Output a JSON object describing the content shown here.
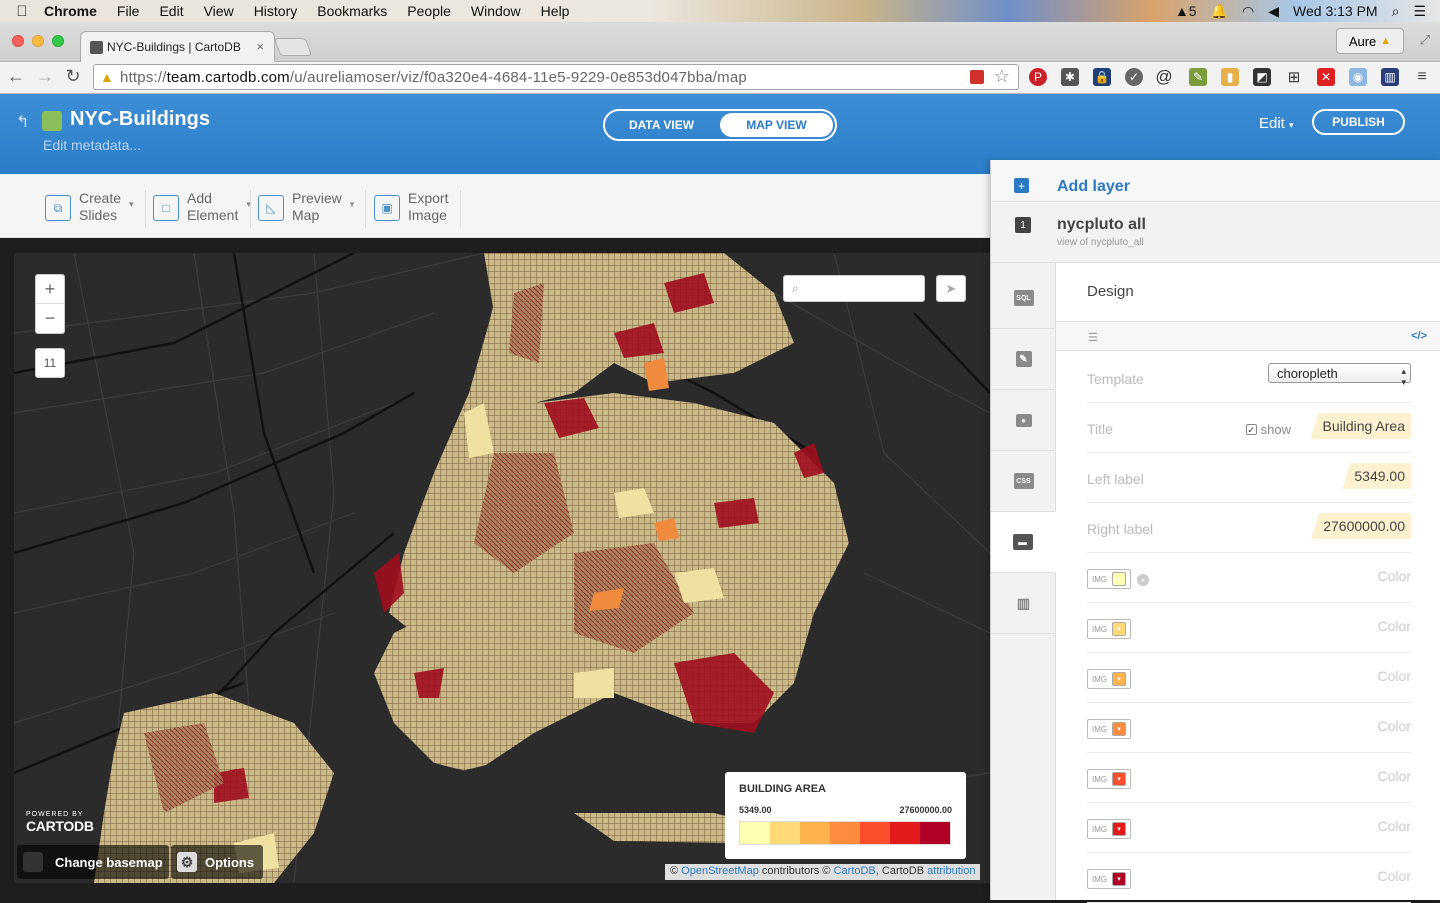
{
  "menubar": {
    "app": "Chrome",
    "items": [
      "File",
      "Edit",
      "View",
      "History",
      "Bookmarks",
      "People",
      "Window",
      "Help"
    ],
    "status_count": "5",
    "clock": "Wed 3:13 PM"
  },
  "browser": {
    "tab_title": "NYC-Buildings | CartoDB",
    "profile": "Aure",
    "url_scheme": "https://",
    "url_host": "team.cartodb.com",
    "url_path": "/u/aureliamoser/viz/f0a320e4-4684-11e5-9229-0e853d047bba/map"
  },
  "header": {
    "title": "NYC-Buildings",
    "edit_metadata": "Edit metadata...",
    "data_view": "DATA VIEW",
    "map_view": "MAP VIEW",
    "edit": "Edit",
    "publish": "PUBLISH"
  },
  "slides_toolbar": {
    "create_1": "Create",
    "create_2": "Slides",
    "add_1": "Add",
    "add_2": "Element",
    "preview_1": "Preview",
    "preview_2": "Map",
    "export_1": "Export",
    "export_2": "Image"
  },
  "map": {
    "zoom_in": "+",
    "zoom_out": "−",
    "zoom_level": "11",
    "powered_by": "POWERED BY",
    "brand": "CARTODB",
    "change_basemap": "Change basemap",
    "options": "Options",
    "attribution": {
      "prefix": "©",
      "osm": "OpenStreetMap",
      "contrib": "contributors ©",
      "cartodb": "CartoDB",
      "mid": ", CartoDB",
      "attr": "attribution"
    },
    "legend": {
      "title": "BUILDING AREA",
      "left": "5349.00",
      "right": "27600000.00",
      "colors": [
        "#ffffb2",
        "#fed976",
        "#feb24c",
        "#fd8d3c",
        "#fc4e2a",
        "#e31a1c",
        "#b10026"
      ]
    }
  },
  "panel": {
    "add_layer": "Add layer",
    "layer_number": "1",
    "layer_name": "nycpluto all",
    "layer_sub": "view of nycpluto_all",
    "tabs": [
      "SQL",
      "wizard",
      "infowindow",
      "CSS",
      "legend",
      "filters"
    ],
    "design_title": "Design",
    "code_toggle": "</>",
    "template_label": "Template",
    "template_value": "choropleth",
    "title_label": "Title",
    "show_label": "show",
    "title_value": "Building Area",
    "left_label": "Left label",
    "left_value": "5349.00",
    "right_label": "Right label",
    "right_value": "27600000.00",
    "img_tag": "IMG",
    "color_label": "Color",
    "colors": [
      "#ffffb2",
      "#fed976",
      "#feb24c",
      "#fd8d3c",
      "#fc4e2a",
      "#e31a1c",
      "#b10026"
    ]
  }
}
